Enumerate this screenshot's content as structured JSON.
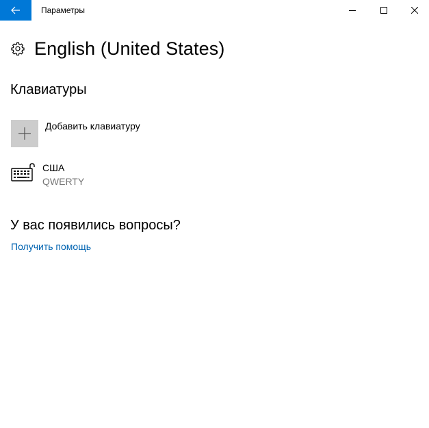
{
  "titlebar": {
    "title": "Параметры",
    "back_icon": "arrow-left-icon",
    "accent_color": "#0078d7",
    "controls": [
      "minimize-icon",
      "maximize-icon",
      "close-icon"
    ]
  },
  "page": {
    "icon": "gear-icon",
    "title": "English (United States)"
  },
  "keyboards": {
    "section_title": "Клавиатуры",
    "add_label": "Добавить клавиатуру",
    "add_icon": "plus-icon",
    "items": [
      {
        "name": "США",
        "layout": "QWERTY",
        "icon": "keyboard-icon"
      }
    ]
  },
  "help": {
    "title": "У вас появились вопросы?",
    "link": "Получить помощь",
    "link_color": "#0063b1"
  }
}
